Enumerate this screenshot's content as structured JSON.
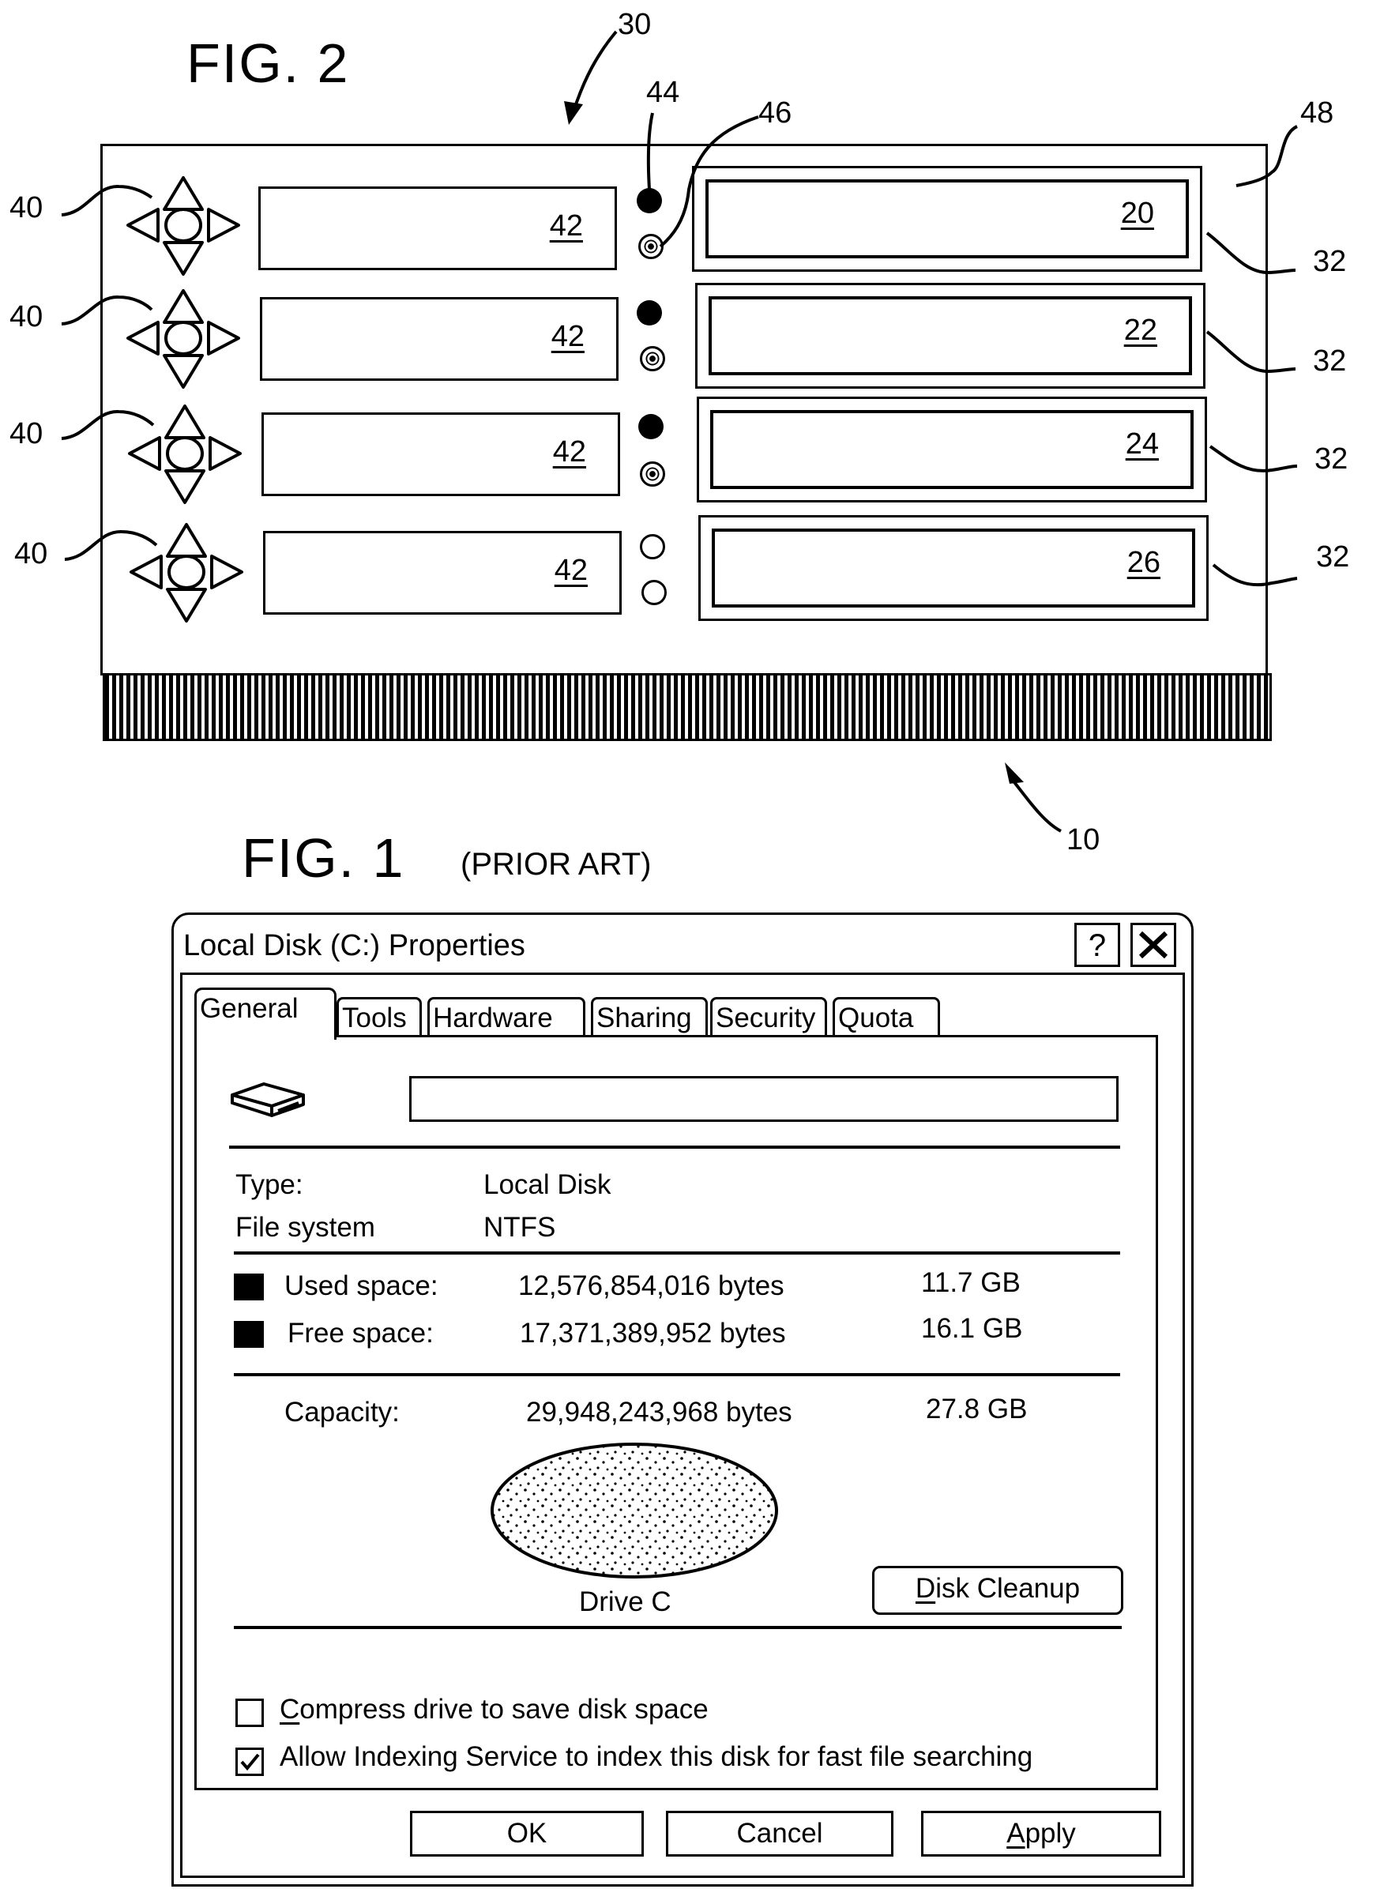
{
  "fig2": {
    "title": "FIG. 2",
    "ref_device": "30",
    "ref_led_primary": "44",
    "ref_led_secondary": "46",
    "ref_housing": "48",
    "ref_base": "10",
    "rows": [
      {
        "nav_ref": "40",
        "display_ref": "42",
        "bay_ref": "32",
        "drive_ref": "20",
        "led_primary": "on",
        "led_secondary": "blinking"
      },
      {
        "nav_ref": "40",
        "display_ref": "42",
        "bay_ref": "32",
        "drive_ref": "22",
        "led_primary": "on",
        "led_secondary": "blinking"
      },
      {
        "nav_ref": "40",
        "display_ref": "42",
        "bay_ref": "32",
        "drive_ref": "24",
        "led_primary": "on",
        "led_secondary": "blinking"
      },
      {
        "nav_ref": "40",
        "display_ref": "42",
        "bay_ref": "32",
        "drive_ref": "26",
        "led_primary": "off",
        "led_secondary": "off"
      }
    ]
  },
  "fig1": {
    "title": "FIG. 1",
    "subtitle": "(PRIOR ART)",
    "dialog": {
      "title": "Local Disk (C:) Properties",
      "help_button": "?",
      "close_icon": "close-icon",
      "tabs": [
        {
          "label": "General",
          "active": true
        },
        {
          "label": "Tools",
          "active": false
        },
        {
          "label": "Hardware",
          "active": false
        },
        {
          "label": "Sharing",
          "active": false
        },
        {
          "label": "Security",
          "active": false
        },
        {
          "label": "Quota",
          "active": false
        }
      ],
      "drive_icon": "drive-icon",
      "name_value": "",
      "type_label": "Type:",
      "type_value": "Local Disk",
      "fs_label": "File system",
      "fs_value": "NTFS",
      "used_label": "Used space:",
      "used_bytes": "12,576,854,016 bytes",
      "used_gb": "11.7 GB",
      "free_label": "Free space:",
      "free_bytes": "17,371,389,952 bytes",
      "free_gb": "16.1 GB",
      "capacity_label": "Capacity:",
      "capacity_bytes": "29,948,243,968 bytes",
      "capacity_gb": "27.8 GB",
      "drive_label": "Drive C",
      "disk_cleanup": {
        "mnemonic": "D",
        "rest": "isk Cleanup"
      },
      "compress": {
        "checked": false,
        "mnemonic": "C",
        "rest": "ompress drive to save disk space"
      },
      "indexing": {
        "checked": true,
        "label": "Allow Indexing Service to index this disk for fast file searching"
      },
      "ok": "OK",
      "cancel": "Cancel",
      "apply": {
        "mnemonic": "A",
        "rest": "pply"
      }
    }
  }
}
